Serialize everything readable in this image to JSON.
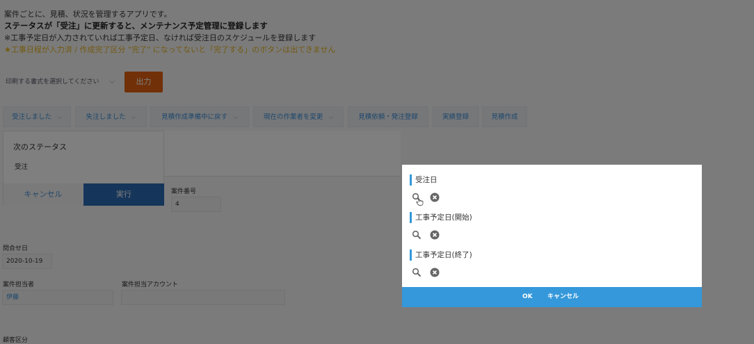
{
  "description": {
    "line1": "案件ごとに、見積、状況を管理するアプリです。",
    "line2": "ステータスが「受注」に更新すると、メンテナンス予定管理に登録します",
    "line3": "※工事予定日が入力されていれば工事予定日、なければ受注日のスケジュールを登録します",
    "line4": "★工事日程が入力済 / 作成完了区分 \"完了\" になってないと「完了する」のボタンは出てきません"
  },
  "print": {
    "select_label": "印刷する書式を選択してください",
    "output_label": "出力"
  },
  "actions": [
    {
      "label": "受注しました"
    },
    {
      "label": "失注しました"
    },
    {
      "label": "見積作成準備中に戻す"
    },
    {
      "label": "現在の作業者を変更"
    },
    {
      "label": "見積依頼・発注登録"
    },
    {
      "label": "実績登録"
    },
    {
      "label": "見積作成"
    }
  ],
  "status_panel": {
    "title": "次のステータス",
    "value": "受注",
    "cancel_label": "キャンセル",
    "execute_label": "実行"
  },
  "form": {
    "case_number_label": "案件番号",
    "case_number_value": "4",
    "inquiry_date_label": "問合せ日",
    "inquiry_date_value": "2020-10-19",
    "case_owner_label": "案件担当者",
    "case_owner_value": "伊藤",
    "case_owner_account_label": "案件担当アカウント",
    "case_owner_account_value": "",
    "sales_type_label": "顧客区分"
  },
  "modal": {
    "sections": [
      {
        "title": "受注日"
      },
      {
        "title": "工事予定日(開始)"
      },
      {
        "title": "工事予定日(終了)"
      }
    ],
    "ok_label": "OK",
    "cancel_label": "キャンセル"
  },
  "colors": {
    "accent": "#3498db",
    "output_button": "#e3600e",
    "execute_button": "#2a6ab5",
    "warning_text": "#e6b422"
  }
}
